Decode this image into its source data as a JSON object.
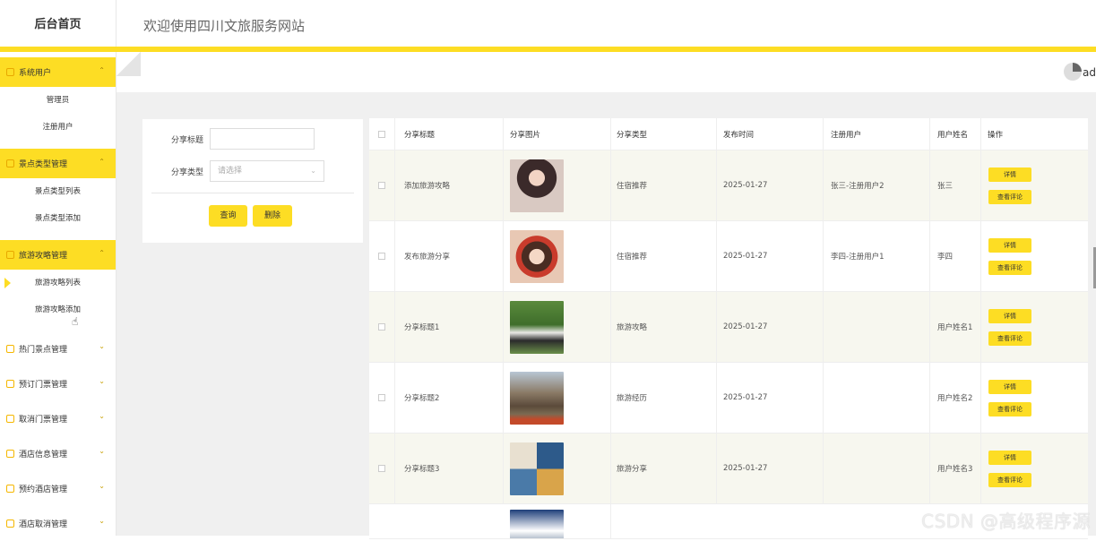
{
  "sidebar": {
    "title": "后台首页",
    "groups": [
      {
        "label": "系统用户",
        "active": true,
        "items": [
          "管理员",
          "注册用户"
        ]
      },
      {
        "label": "景点类型管理",
        "active": true,
        "items": [
          "景点类型列表",
          "景点类型添加"
        ]
      },
      {
        "label": "旅游攻略管理",
        "active": true,
        "items": [
          "旅游攻略列表",
          "旅游攻略添加"
        ]
      },
      {
        "label": "热门景点管理"
      },
      {
        "label": "预订门票管理"
      },
      {
        "label": "取消门票管理"
      },
      {
        "label": "酒店信息管理"
      },
      {
        "label": "预约酒店管理"
      },
      {
        "label": "酒店取消管理"
      }
    ]
  },
  "header": {
    "welcome": "欢迎使用四川文旅服务网站",
    "account": "ad"
  },
  "search": {
    "title_label": "分享标题",
    "title_value": "",
    "type_label": "分享类型",
    "type_placeholder": "请选择",
    "query_button": "查询",
    "delete_button": "删除"
  },
  "table": {
    "columns": [
      "分享标题",
      "分享图片",
      "分享类型",
      "发布时间",
      "注册用户",
      "用户姓名",
      "操作"
    ],
    "rows": [
      {
        "title": "添加旅游攻略",
        "type": "住宿推荐",
        "time": "2025-01-27",
        "user": "张三-注册用户2",
        "name": "张三"
      },
      {
        "title": "发布旅游分享",
        "type": "住宿推荐",
        "time": "2025-01-27",
        "user": "李四-注册用户1",
        "name": "李四"
      },
      {
        "title": "分享标题1",
        "type": "旅游攻略",
        "time": "2025-01-27",
        "user": "",
        "name": "用户姓名1"
      },
      {
        "title": "分享标题2",
        "type": "旅游经历",
        "time": "2025-01-27",
        "user": "",
        "name": "用户姓名2"
      },
      {
        "title": "分享标题3",
        "type": "旅游分享",
        "time": "2025-01-27",
        "user": "",
        "name": "用户姓名3"
      }
    ],
    "detail_button": "详情",
    "comment_button": "查看评论"
  },
  "watermark": "CSDN @高级程序源"
}
